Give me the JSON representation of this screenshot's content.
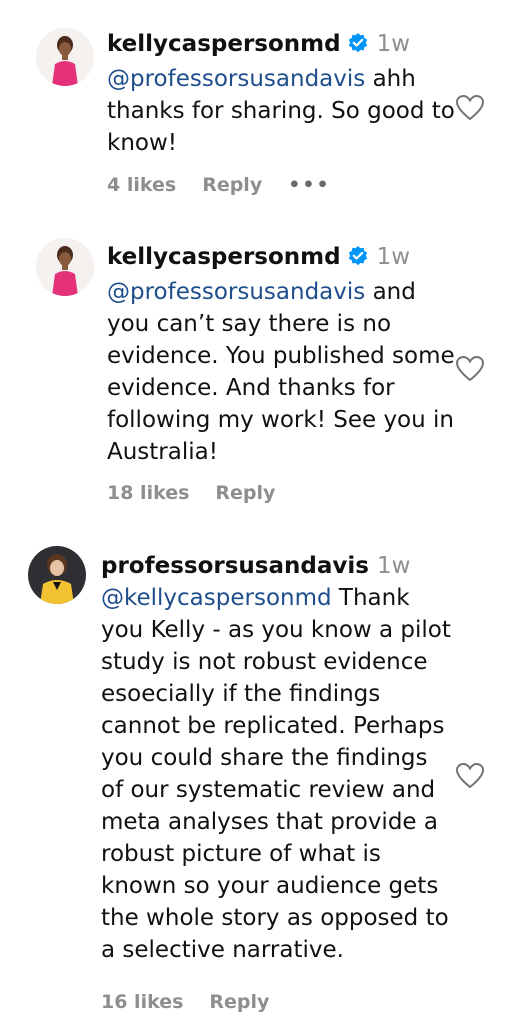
{
  "comments": [
    {
      "username": "kellycaspersonmd",
      "time": "1w",
      "verified": true,
      "mention": "@professorsusandavis",
      "first_line_rest": " ahh",
      "lines": [
        "thanks for sharing. So good to",
        "know!"
      ],
      "likes": "4 likes",
      "reply": "Reply",
      "more": "•••"
    },
    {
      "username": "kellycaspersonmd",
      "time": "1w",
      "verified": true,
      "mention": "@professorsusandavis",
      "first_line_rest": " and",
      "lines": [
        "you can’t say there is no",
        "evidence. You published some",
        "evidence. And thanks for",
        "following my work! See you in",
        "Australia!"
      ],
      "likes": "18 likes",
      "reply": "Reply"
    },
    {
      "username": "professorsusandavis",
      "time": "1w",
      "verified": false,
      "mention": "@kellycaspersonmd",
      "first_line_rest": " Thank",
      "lines": [
        "you Kelly - as you know a pilot",
        "study is not robust evidence",
        "esoecially if the findings",
        "cannot be replicated. Perhaps",
        "you could share the findings",
        "of our systematic review and",
        "meta analyses that provide a",
        "robust picture of what is",
        "known so your audience gets",
        "the whole story as opposed to",
        "a selective narrative."
      ],
      "likes": "16 likes",
      "reply": "Reply"
    }
  ],
  "colors": {
    "mention": "#1f4e8c",
    "verified": "#0095f6",
    "muted": "#8e8e8e"
  },
  "icons": [
    "verified-badge-icon",
    "heart-icon",
    "more-options-icon"
  ]
}
